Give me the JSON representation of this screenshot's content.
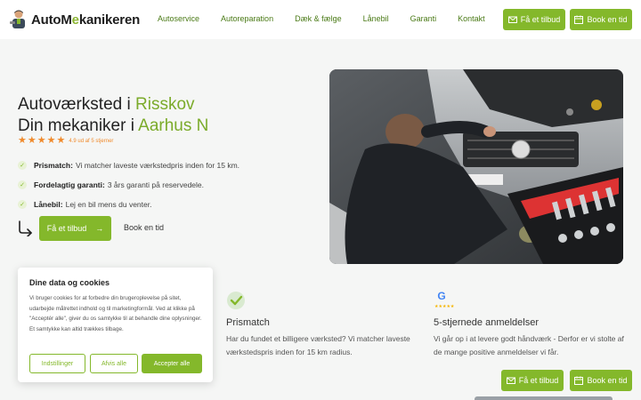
{
  "header": {
    "logo": {
      "text_prefix": "AutoM",
      "text_accent": "e",
      "text_suffix": "kanikeren"
    },
    "nav": [
      "Autoservice",
      "Autoreparation",
      "Dæk & fælge",
      "Lånebil",
      "Garanti",
      "Kontakt"
    ],
    "offer_button": "Få et tilbud",
    "book_button": "Book en tid"
  },
  "hero": {
    "title_line1_prefix": "Autoværksted i ",
    "title_line1_highlight": "Risskov",
    "title_line2_prefix": "Din mekaniker i ",
    "title_line2_highlight": "Aarhus N",
    "rating": {
      "stars": 5,
      "text": "4.9 ud af 5 stjerner"
    },
    "features": [
      {
        "title": "Prismatch:",
        "text": "Vi matcher laveste værkstedpris inden for 15 km."
      },
      {
        "title": "Fordelagtig garanti:",
        "text": "3 års garanti på reservedele."
      },
      {
        "title": "Lånebil:",
        "text": "Lej en bil mens du venter."
      }
    ],
    "cta_offer": "Få et tilbud",
    "cta_book": "Book en tid"
  },
  "benefits": [
    {
      "icon": "checkmark-badge-icon",
      "title": "Prismatch",
      "text": "Har du fundet et billigere værksted? Vi matcher laveste værkstedspris inden for 15 km radius."
    },
    {
      "icon": "google-reviews-icon",
      "title": "5-stjernede anmeldelser",
      "text": "Vi går op i at levere godt håndværk - Derfor er vi stolte af de mange positive anmeldelser vi får."
    }
  ],
  "cookie": {
    "title": "Dine data og cookies",
    "text": "Vi bruger cookies for at forbedre din brugeroplevelse på sitet, udarbejde målrettet indhold og til marketingformål. Ved at klikke på \"Acceptér alle\", giver du os samtykke til at behandle dine oplysninger. Et samtykke kan altid trækkes tilbage.",
    "settings_button": "Indstillinger",
    "reject_button": "Afvis alle",
    "accept_button": "Accepter alle"
  },
  "sticky": {
    "offer_button": "Få et tilbud",
    "book_button": "Book en tid"
  },
  "colors": {
    "accent": "#84b82b",
    "highlight_text": "#7bab2a",
    "star": "#f08a2c",
    "nav_text": "#4a7a16"
  }
}
